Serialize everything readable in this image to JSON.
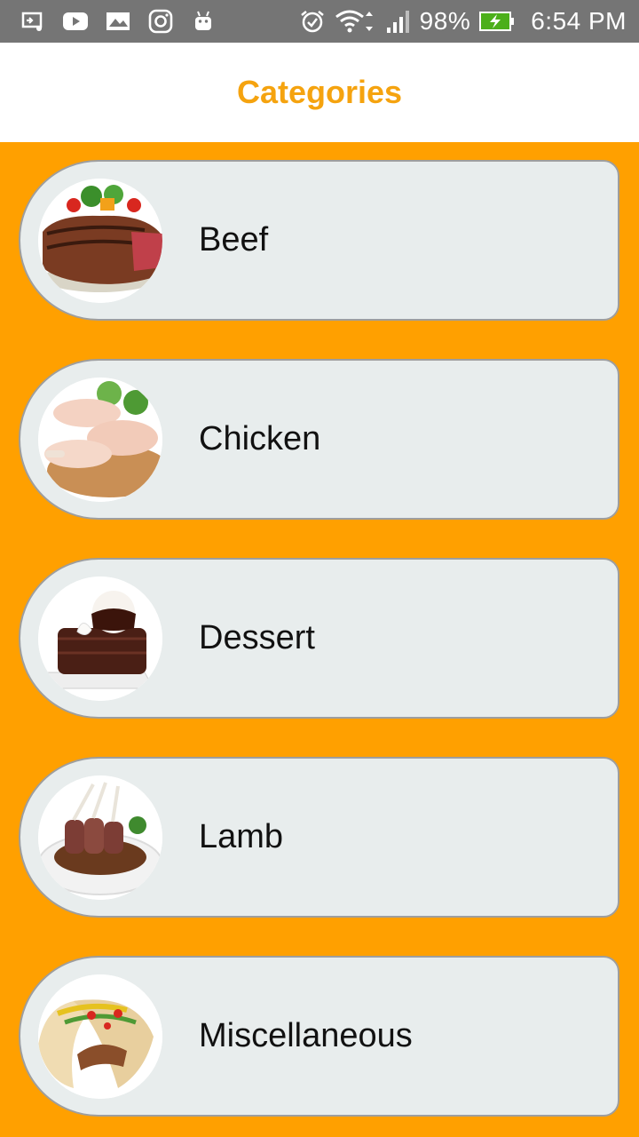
{
  "status_bar": {
    "left_icons": [
      "cast-icon",
      "youtube-icon",
      "gallery-icon",
      "instagram-icon",
      "android-icon"
    ],
    "right_icons": [
      "alarm-icon",
      "wifi-icon",
      "signal-icon",
      "battery-charging-icon"
    ],
    "battery_percent": "98%",
    "time": "6:54 PM",
    "battery_color": "#4caf1a"
  },
  "app_bar": {
    "title": "Categories",
    "title_color": "#f5a30f"
  },
  "colors": {
    "background": "#ffa000",
    "card": "#e8eded",
    "card_border": "#9e9e9e"
  },
  "categories": [
    {
      "label": "Beef",
      "image": "beef-steak-image"
    },
    {
      "label": "Chicken",
      "image": "raw-chicken-image"
    },
    {
      "label": "Dessert",
      "image": "chocolate-dessert-image"
    },
    {
      "label": "Lamb",
      "image": "lamb-rack-image"
    },
    {
      "label": "Miscellaneous",
      "image": "tacos-image"
    }
  ]
}
